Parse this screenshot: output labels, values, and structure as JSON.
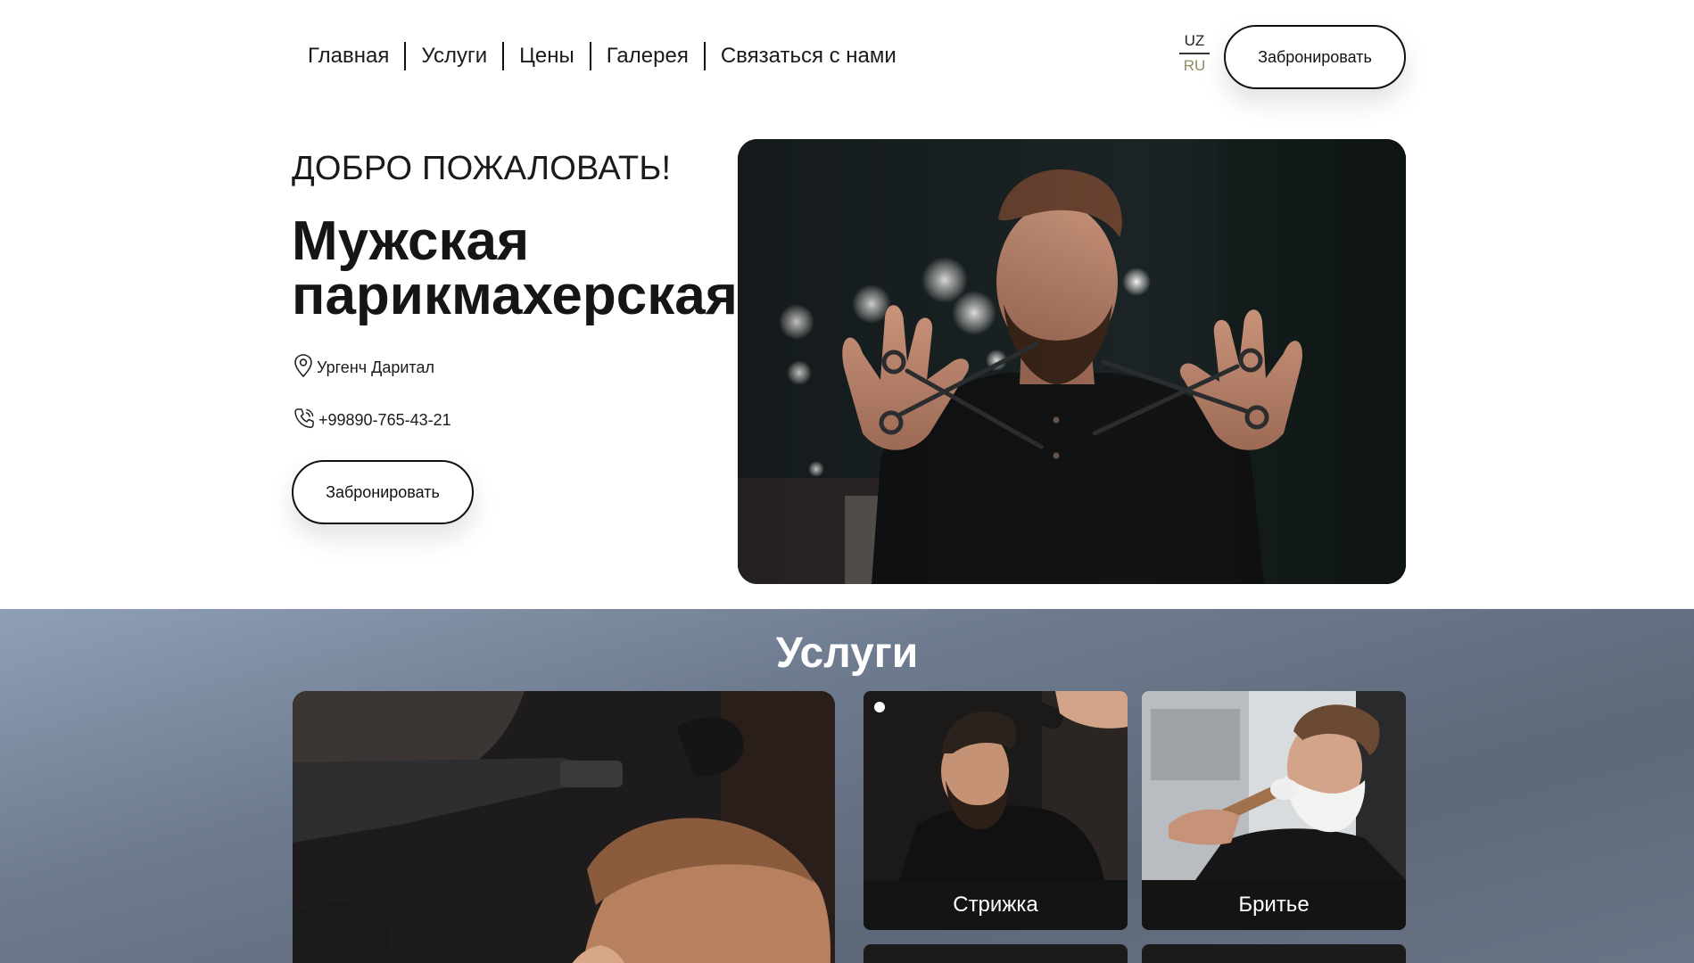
{
  "nav": {
    "items": [
      {
        "label": "Главная"
      },
      {
        "label": "Услуги"
      },
      {
        "label": "Цены"
      },
      {
        "label": "Галерея"
      },
      {
        "label": "Связаться с нами"
      }
    ]
  },
  "lang": {
    "uz": "UZ",
    "ru": "RU"
  },
  "header": {
    "book_label": "Забронировать"
  },
  "hero": {
    "welcome": "ДОБРО ПОЖАЛОВАТЬ!",
    "title": "Мужская парикмахерская",
    "address": "Ургенч Даритал",
    "phone": "+99890-765-43-21",
    "book_label": "Забронировать"
  },
  "services": {
    "title": "Услуги",
    "cards": [
      {
        "label": "Стрижка"
      },
      {
        "label": "Бритье"
      }
    ]
  },
  "colors": {
    "accent_ru": "#8f8d62",
    "services_bg": "#6e7b8f",
    "card_label_bg": "#141414"
  },
  "icons": [
    "location-pin-icon",
    "phone-icon"
  ]
}
